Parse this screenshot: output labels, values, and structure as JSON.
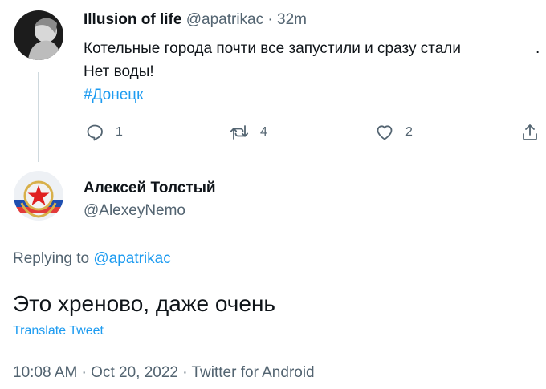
{
  "parent_tweet": {
    "display_name": "Illusion of life",
    "handle_time": "@apatrikac · 32m",
    "text_line1": "Котельные города почти все запустили и сразу стали",
    "text_line1_tail": ".",
    "text_line2": "Нет воды!",
    "hashtag": "#Донецк",
    "actions": {
      "reply_count": "1",
      "retweet_count": "4",
      "like_count": "2"
    }
  },
  "reply": {
    "display_name": "Алексей Толстый",
    "handle": "@AlexeyNemo",
    "replying_prefix": "Replying to",
    "replying_handle": "@apatrikac",
    "text": "Это хреново, даже очень",
    "translate": "Translate Tweet",
    "meta": "10:08 AM · Oct 20, 2022 · Twitter for Android"
  },
  "icons": {
    "reply": "reply-icon",
    "retweet": "retweet-icon",
    "like": "heart-icon",
    "share": "share-icon"
  }
}
